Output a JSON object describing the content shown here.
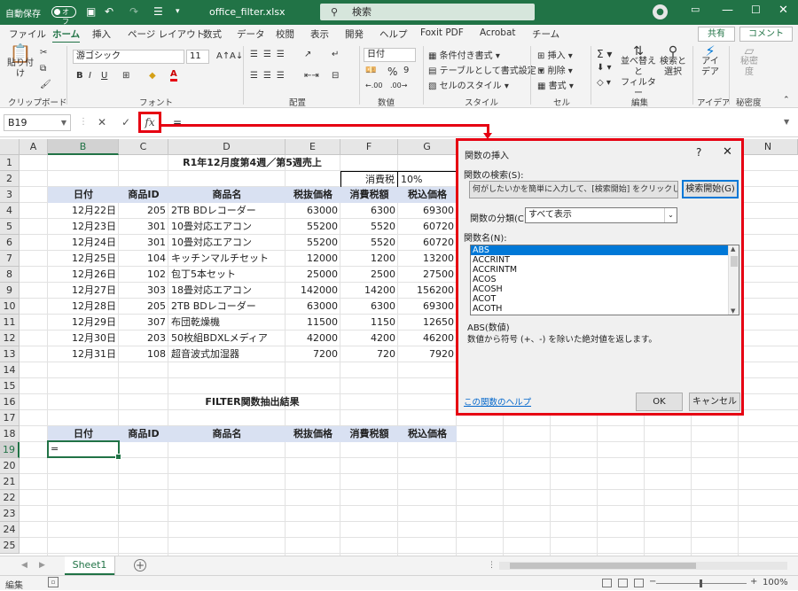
{
  "titlebar": {
    "autosave_label": "自動保存",
    "autosave_state": "オフ",
    "filename": "office_filter.xlsx",
    "search_placeholder": "検索"
  },
  "tabs": [
    "ファイル",
    "ホーム",
    "挿入",
    "ページ レイアウト",
    "数式",
    "データ",
    "校閲",
    "表示",
    "開発",
    "ヘルプ",
    "Foxit PDF",
    "Acrobat",
    "チーム"
  ],
  "share_label": "共有",
  "comment_label": "コメント",
  "ribbon": {
    "clipboard": {
      "paste": "貼り付け",
      "label": "クリップボード"
    },
    "font": {
      "name": "游ゴシック",
      "size": "11",
      "bold": "B",
      "italic": "I",
      "underline": "U",
      "label": "フォント"
    },
    "alignment": {
      "label": "配置"
    },
    "number": {
      "format": "日付",
      "label": "数値"
    },
    "styles": {
      "conditional": "条件付き書式",
      "table": "テーブルとして書式設定",
      "cell": "セルのスタイル",
      "label": "スタイル"
    },
    "cells": {
      "insert": "挿入",
      "delete": "削除",
      "format": "書式",
      "label": "セル"
    },
    "editing": {
      "sort": "並べ替えと",
      "sort2": "フィルター",
      "find": "検索と",
      "find2": "選択",
      "label": "編集"
    },
    "ideas": {
      "label1": "アイ",
      "label2": "デア",
      "group": "アイデア"
    },
    "sensitivity": {
      "label1": "秘密",
      "label2": "度",
      "group": "秘密度"
    }
  },
  "formula_bar": {
    "namebox": "B19",
    "fx": "fx",
    "content": "="
  },
  "columns": [
    "A",
    "B",
    "C",
    "D",
    "E",
    "F",
    "G",
    "H",
    "I",
    "J",
    "K",
    "L",
    "M",
    "N"
  ],
  "rows": [
    "1",
    "2",
    "3",
    "4",
    "5",
    "6",
    "7",
    "8",
    "9",
    "10",
    "11",
    "12",
    "13",
    "14",
    "15",
    "16",
    "17",
    "18",
    "19",
    "20",
    "21",
    "22",
    "23",
    "24",
    "25"
  ],
  "sheet": {
    "title": "R1年12月度第4週／第5週売上",
    "tax_label": "消費税",
    "tax_value": "10%",
    "headers": [
      "日付",
      "商品ID",
      "商品名",
      "税抜価格",
      "消費税額",
      "税込価格"
    ],
    "rows": [
      [
        "12月22日",
        "205",
        "2TB BDレコーダー",
        "63000",
        "6300",
        "69300"
      ],
      [
        "12月23日",
        "301",
        "10畳対応エアコン",
        "55200",
        "5520",
        "60720"
      ],
      [
        "12月24日",
        "301",
        "10畳対応エアコン",
        "55200",
        "5520",
        "60720"
      ],
      [
        "12月25日",
        "104",
        "キッチンマルチセット",
        "12000",
        "1200",
        "13200"
      ],
      [
        "12月26日",
        "102",
        "包丁5本セット",
        "25000",
        "2500",
        "27500"
      ],
      [
        "12月27日",
        "303",
        "18畳対応エアコン",
        "142000",
        "14200",
        "156200"
      ],
      [
        "12月28日",
        "205",
        "2TB BDレコーダー",
        "63000",
        "6300",
        "69300"
      ],
      [
        "12月29日",
        "307",
        "布団乾燥機",
        "11500",
        "1150",
        "12650"
      ],
      [
        "12月30日",
        "203",
        "50枚組BDXLメディア",
        "42000",
        "4200",
        "46200"
      ],
      [
        "12月31日",
        "108",
        "超音波式加湿器",
        "7200",
        "720",
        "7920"
      ]
    ],
    "filter_title": "FILTER関数抽出結果",
    "filter_headers": [
      "日付",
      "商品ID",
      "商品名",
      "税抜価格",
      "消費税額",
      "税込価格"
    ],
    "active_value": "="
  },
  "sheet_tab": "Sheet1",
  "status": {
    "mode": "編集",
    "zoom": "100%"
  },
  "dialog": {
    "title": "関数の挿入",
    "help": "?",
    "close": "✕",
    "search_label": "関数の検索(S):",
    "search_text": "何がしたいかを簡単に入力して、[検索開始] をクリックしてください。",
    "search_button": "検索開始(G)",
    "category_label": "関数の分類(C):",
    "category_value": "すべて表示",
    "list_label": "関数名(N):",
    "functions": [
      "ABS",
      "ACCRINT",
      "ACCRINTM",
      "ACOS",
      "ACOSH",
      "ACOT",
      "ACOTH"
    ],
    "signature": "ABS(数値)",
    "description": "数値から符号 (+、-) を除いた絶対値を返します。",
    "help_link": "この関数のヘルプ",
    "ok": "OK",
    "cancel": "キャンセル"
  },
  "colors": {
    "excel_green": "#217346",
    "highlight_red": "#e60012",
    "header_fill": "#d9e1f2",
    "selection_blue": "#0078d7"
  }
}
